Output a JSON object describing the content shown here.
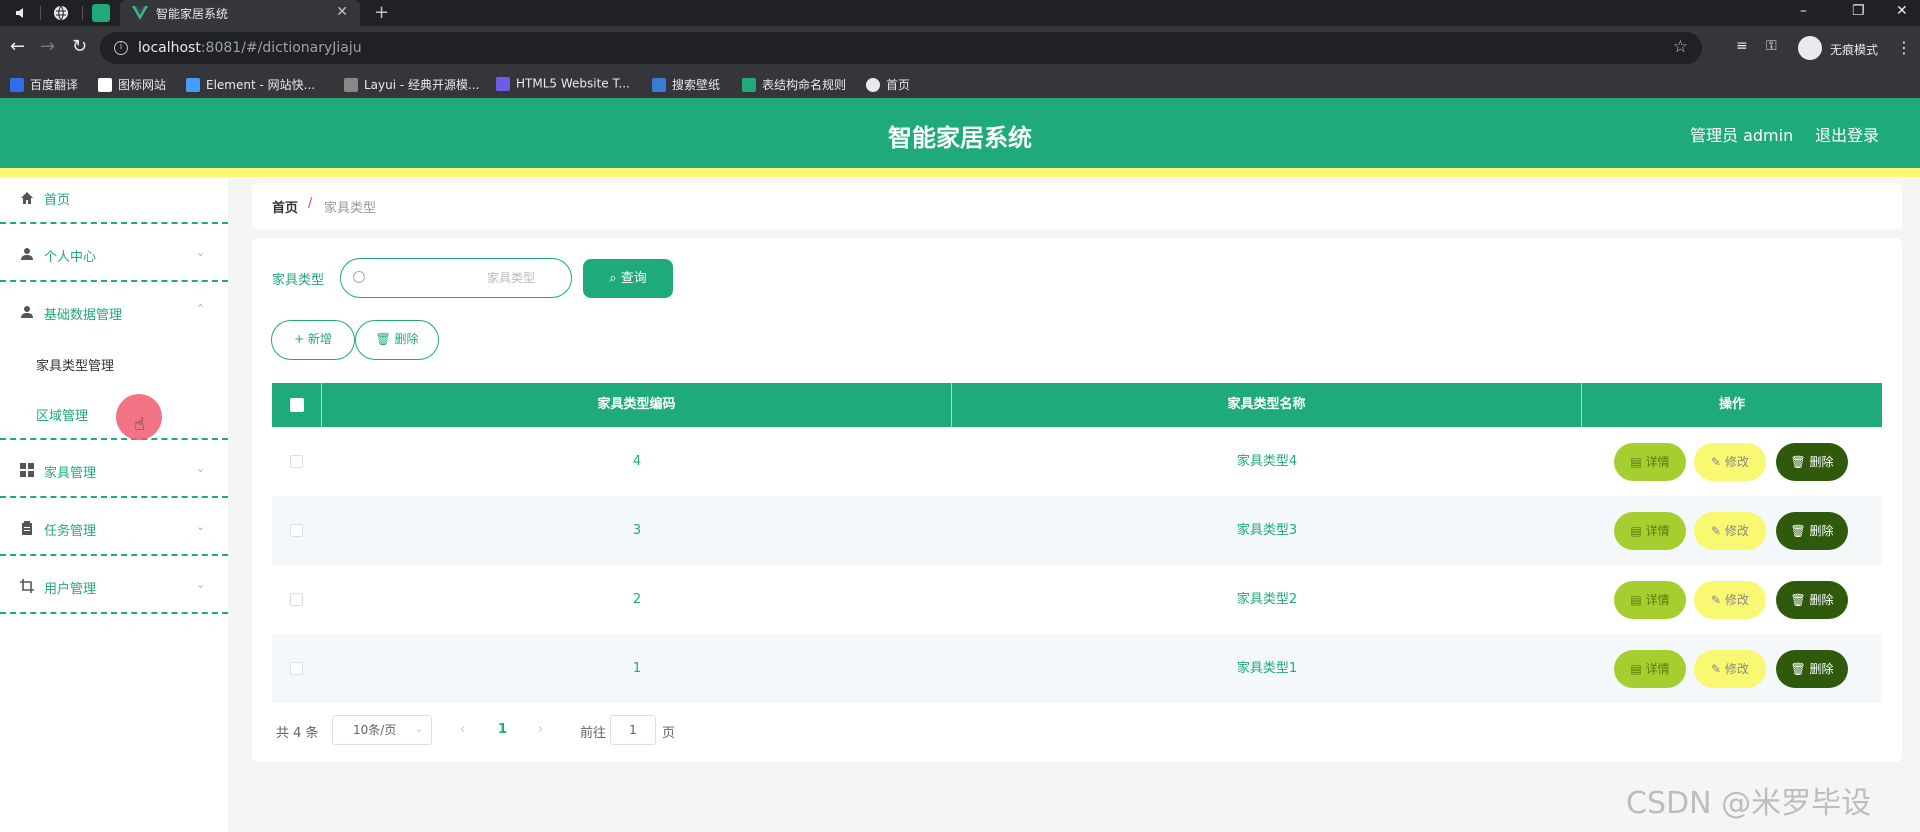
{
  "browser": {
    "active_tab_title": "智能家居系统",
    "url_host": "localhost",
    "url_path": ":8081/#/dictionaryJiaju",
    "incognito_label": "无痕模式",
    "bookmarks": [
      "百度翻译",
      "图标网站",
      "Element - 网站快...",
      "Layui - 经典开源模...",
      "HTML5 Website T...",
      "搜索壁纸",
      "表结构命名规则",
      "首页"
    ]
  },
  "header": {
    "title": "智能家居系统",
    "user": "管理员 admin",
    "logout": "退出登录"
  },
  "sidebar": {
    "items": [
      {
        "label": "首页",
        "icon": "home-icon"
      },
      {
        "label": "个人中心",
        "icon": "user-icon"
      },
      {
        "label": "基础数据管理",
        "icon": "user-icon"
      },
      {
        "label": "家具管理",
        "icon": "grid-icon"
      },
      {
        "label": "任务管理",
        "icon": "clipboard-icon"
      },
      {
        "label": "用户管理",
        "icon": "crop-icon"
      }
    ],
    "sub_items": [
      "家具类型管理",
      "区域管理"
    ]
  },
  "breadcrumb": {
    "home": "首页",
    "separator": "/",
    "current": "家具类型"
  },
  "search": {
    "label": "家具类型",
    "placeholder": "家具类型",
    "query_button": "查询"
  },
  "actions": {
    "add": "+ 新增",
    "delete": "删除"
  },
  "table": {
    "columns": [
      "家具类型编码",
      "家具类型名称",
      "操作"
    ],
    "rows": [
      {
        "code": "4",
        "name": "家具类型4"
      },
      {
        "code": "3",
        "name": "家具类型3"
      },
      {
        "code": "2",
        "name": "家具类型2"
      },
      {
        "code": "1",
        "name": "家具类型1"
      }
    ],
    "row_actions": {
      "detail": "详情",
      "edit": "修改",
      "delete": "删除"
    }
  },
  "pagination": {
    "total": "共 4 条",
    "page_size": "10条/页",
    "prev": "‹",
    "current_page": "1",
    "next": "›",
    "goto_label": "前往",
    "goto_value": "1",
    "page_unit": "页"
  },
  "watermark": "CSDN @米罗毕设",
  "colors": {
    "primary": "#1eab79",
    "accent_yellow": "#f9f871",
    "detail_btn": "#a5cf2e",
    "delete_btn": "#2f5a0c"
  }
}
